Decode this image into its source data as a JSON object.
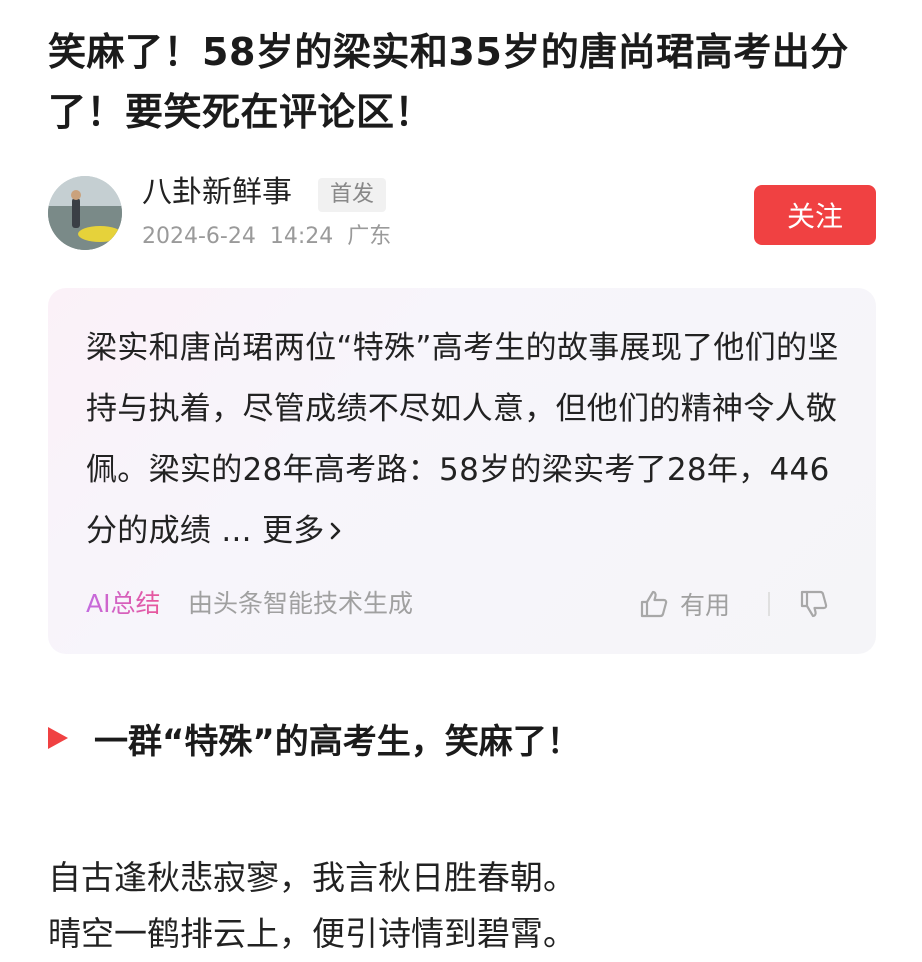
{
  "article": {
    "title": "笑麻了！58岁的梁实和35岁的唐尚珺高考出分了！要笑死在评论区！"
  },
  "author": {
    "name": "八卦新鲜事",
    "badge": "首发",
    "date": "2024-6-24",
    "time": "14:24",
    "location": "广东",
    "follow_label": "关注"
  },
  "summary": {
    "text": "梁实和唐尚珺两位“特殊”高考生的故事展现了他们的坚持与执着，尽管成绩不尽如人意，但他们的精神令人敬佩。梁实的28年高考路：58岁的梁实考了28年，446分的成绩 ...",
    "more_label": "更多",
    "ai_label": "AI总结",
    "source_label": "由头条智能技术生成",
    "useful_label": "有用"
  },
  "section": {
    "title": "一群“特殊”的高考生，笑麻了！"
  },
  "body": {
    "line1": "自古逢秋悲寂寥，我言秋日胜春朝。",
    "line2": "晴空一鹤排云上，便引诗情到碧霄。"
  },
  "colors": {
    "accent": "#f04142",
    "ai_gradient_start": "#c46be0",
    "ai_gradient_end": "#e8569a"
  },
  "icons": {
    "thumbs_up": "thumbs-up-icon",
    "thumbs_down": "thumbs-down-icon",
    "chevron": "chevron-right-icon",
    "section_marker": "triangle-marker-icon"
  }
}
